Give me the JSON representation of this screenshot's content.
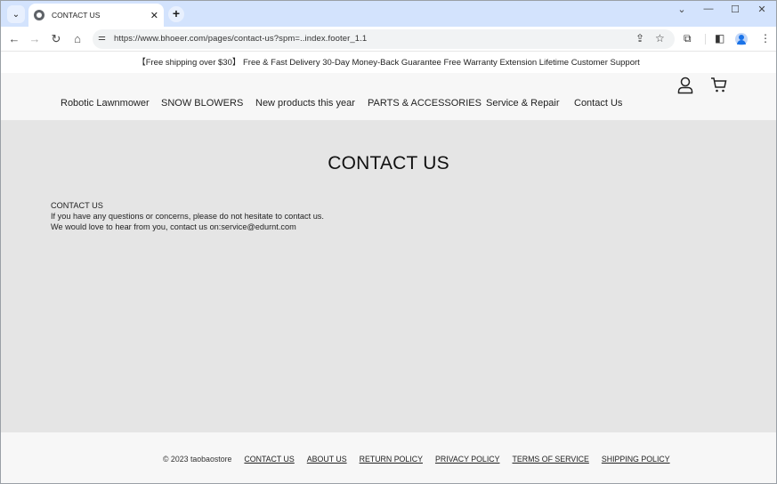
{
  "browser": {
    "tab": {
      "title": "CONTACT US",
      "icon": "globe-icon"
    },
    "url": "https://www.bhoeer.com/pages/contact-us?spm=..index.footer_1.1",
    "controls": {
      "tab_search": "⌄",
      "close_tab": "✕",
      "new_tab": "+",
      "minimize": "—",
      "maximize": "☐",
      "close_window": "✕",
      "chevron": "⌄",
      "back": "←",
      "forward": "→",
      "reload": "↻",
      "home": "⌂",
      "site_info": "⚌",
      "share": "⇪",
      "bookmark": "☆",
      "extensions": "⧉",
      "side_panel": "◧",
      "menu": "⋮"
    }
  },
  "site": {
    "announcement": "【Free shipping over $30】 Free & Fast Delivery 30-Day Money-Back Guarantee Free Warranty Extension Lifetime Customer Support",
    "nav": [
      {
        "label": "Robotic Lawnmower"
      },
      {
        "label": "SNOW BLOWERS"
      },
      {
        "label": "New products this year"
      },
      {
        "label": "PARTS & ACCESSORIES"
      },
      {
        "label": "Service & Repair"
      },
      {
        "label": "Contact Us"
      }
    ],
    "header_icons": {
      "account": "account-icon",
      "cart": "cart-icon"
    }
  },
  "main": {
    "title": "CONTACT US",
    "lines": [
      "CONTACT US",
      "If you have any questions or concerns, please do not hesitate to contact us.",
      "We would love to hear from you, contact us on:service@edurnt.com"
    ]
  },
  "footer": {
    "copyright": "© 2023 taobaostore",
    "links": [
      {
        "label": "CONTACT US"
      },
      {
        "label": "ABOUT US"
      },
      {
        "label": "RETURN POLICY"
      },
      {
        "label": "PRIVACY POLICY"
      },
      {
        "label": "TERMS OF SERVICE"
      },
      {
        "label": "SHIPPING POLICY"
      }
    ]
  }
}
